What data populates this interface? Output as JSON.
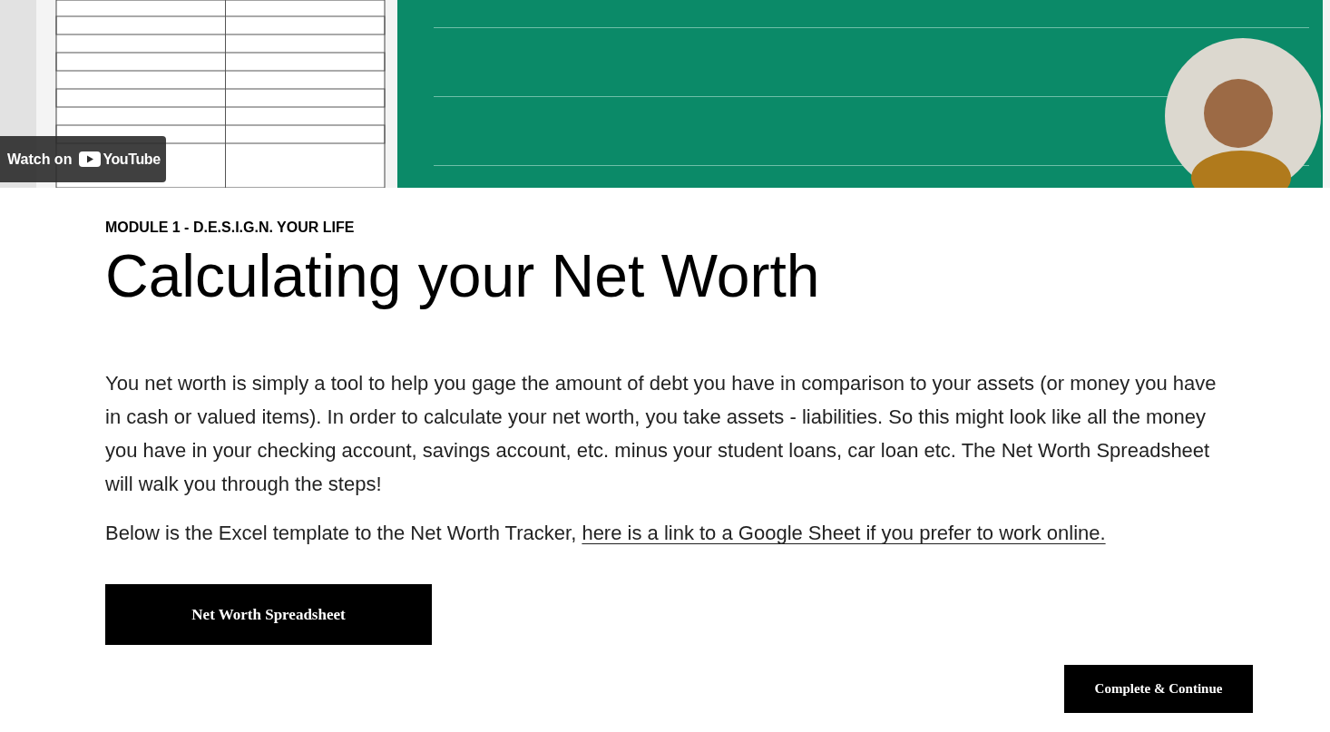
{
  "video": {
    "watch_label": "Watch on",
    "brand": "YouTube"
  },
  "module_label": "MODULE 1 - D.E.S.I.G.N. YOUR LIFE",
  "title": "Calculating your Net Worth",
  "paragraphs": [
    {
      "text": "You net worth is simply a tool to help you gage the amount of debt you have in comparison to your assets (or money you have in cash or valued items). In order to calculate your net worth, you take assets - liabilities. So this might look like all the money you have in your checking account, savings account, etc. minus your student loans, car loan etc. The Net Worth Spreadsheet will walk you through the steps!"
    },
    {
      "text": "Below is the Excel template to the Net Worth Tracker, ",
      "link": "here is a link to a Google Sheet if you prefer to work online."
    }
  ],
  "download_button": "Net Worth Spreadsheet",
  "complete_button": "Complete & Continue"
}
